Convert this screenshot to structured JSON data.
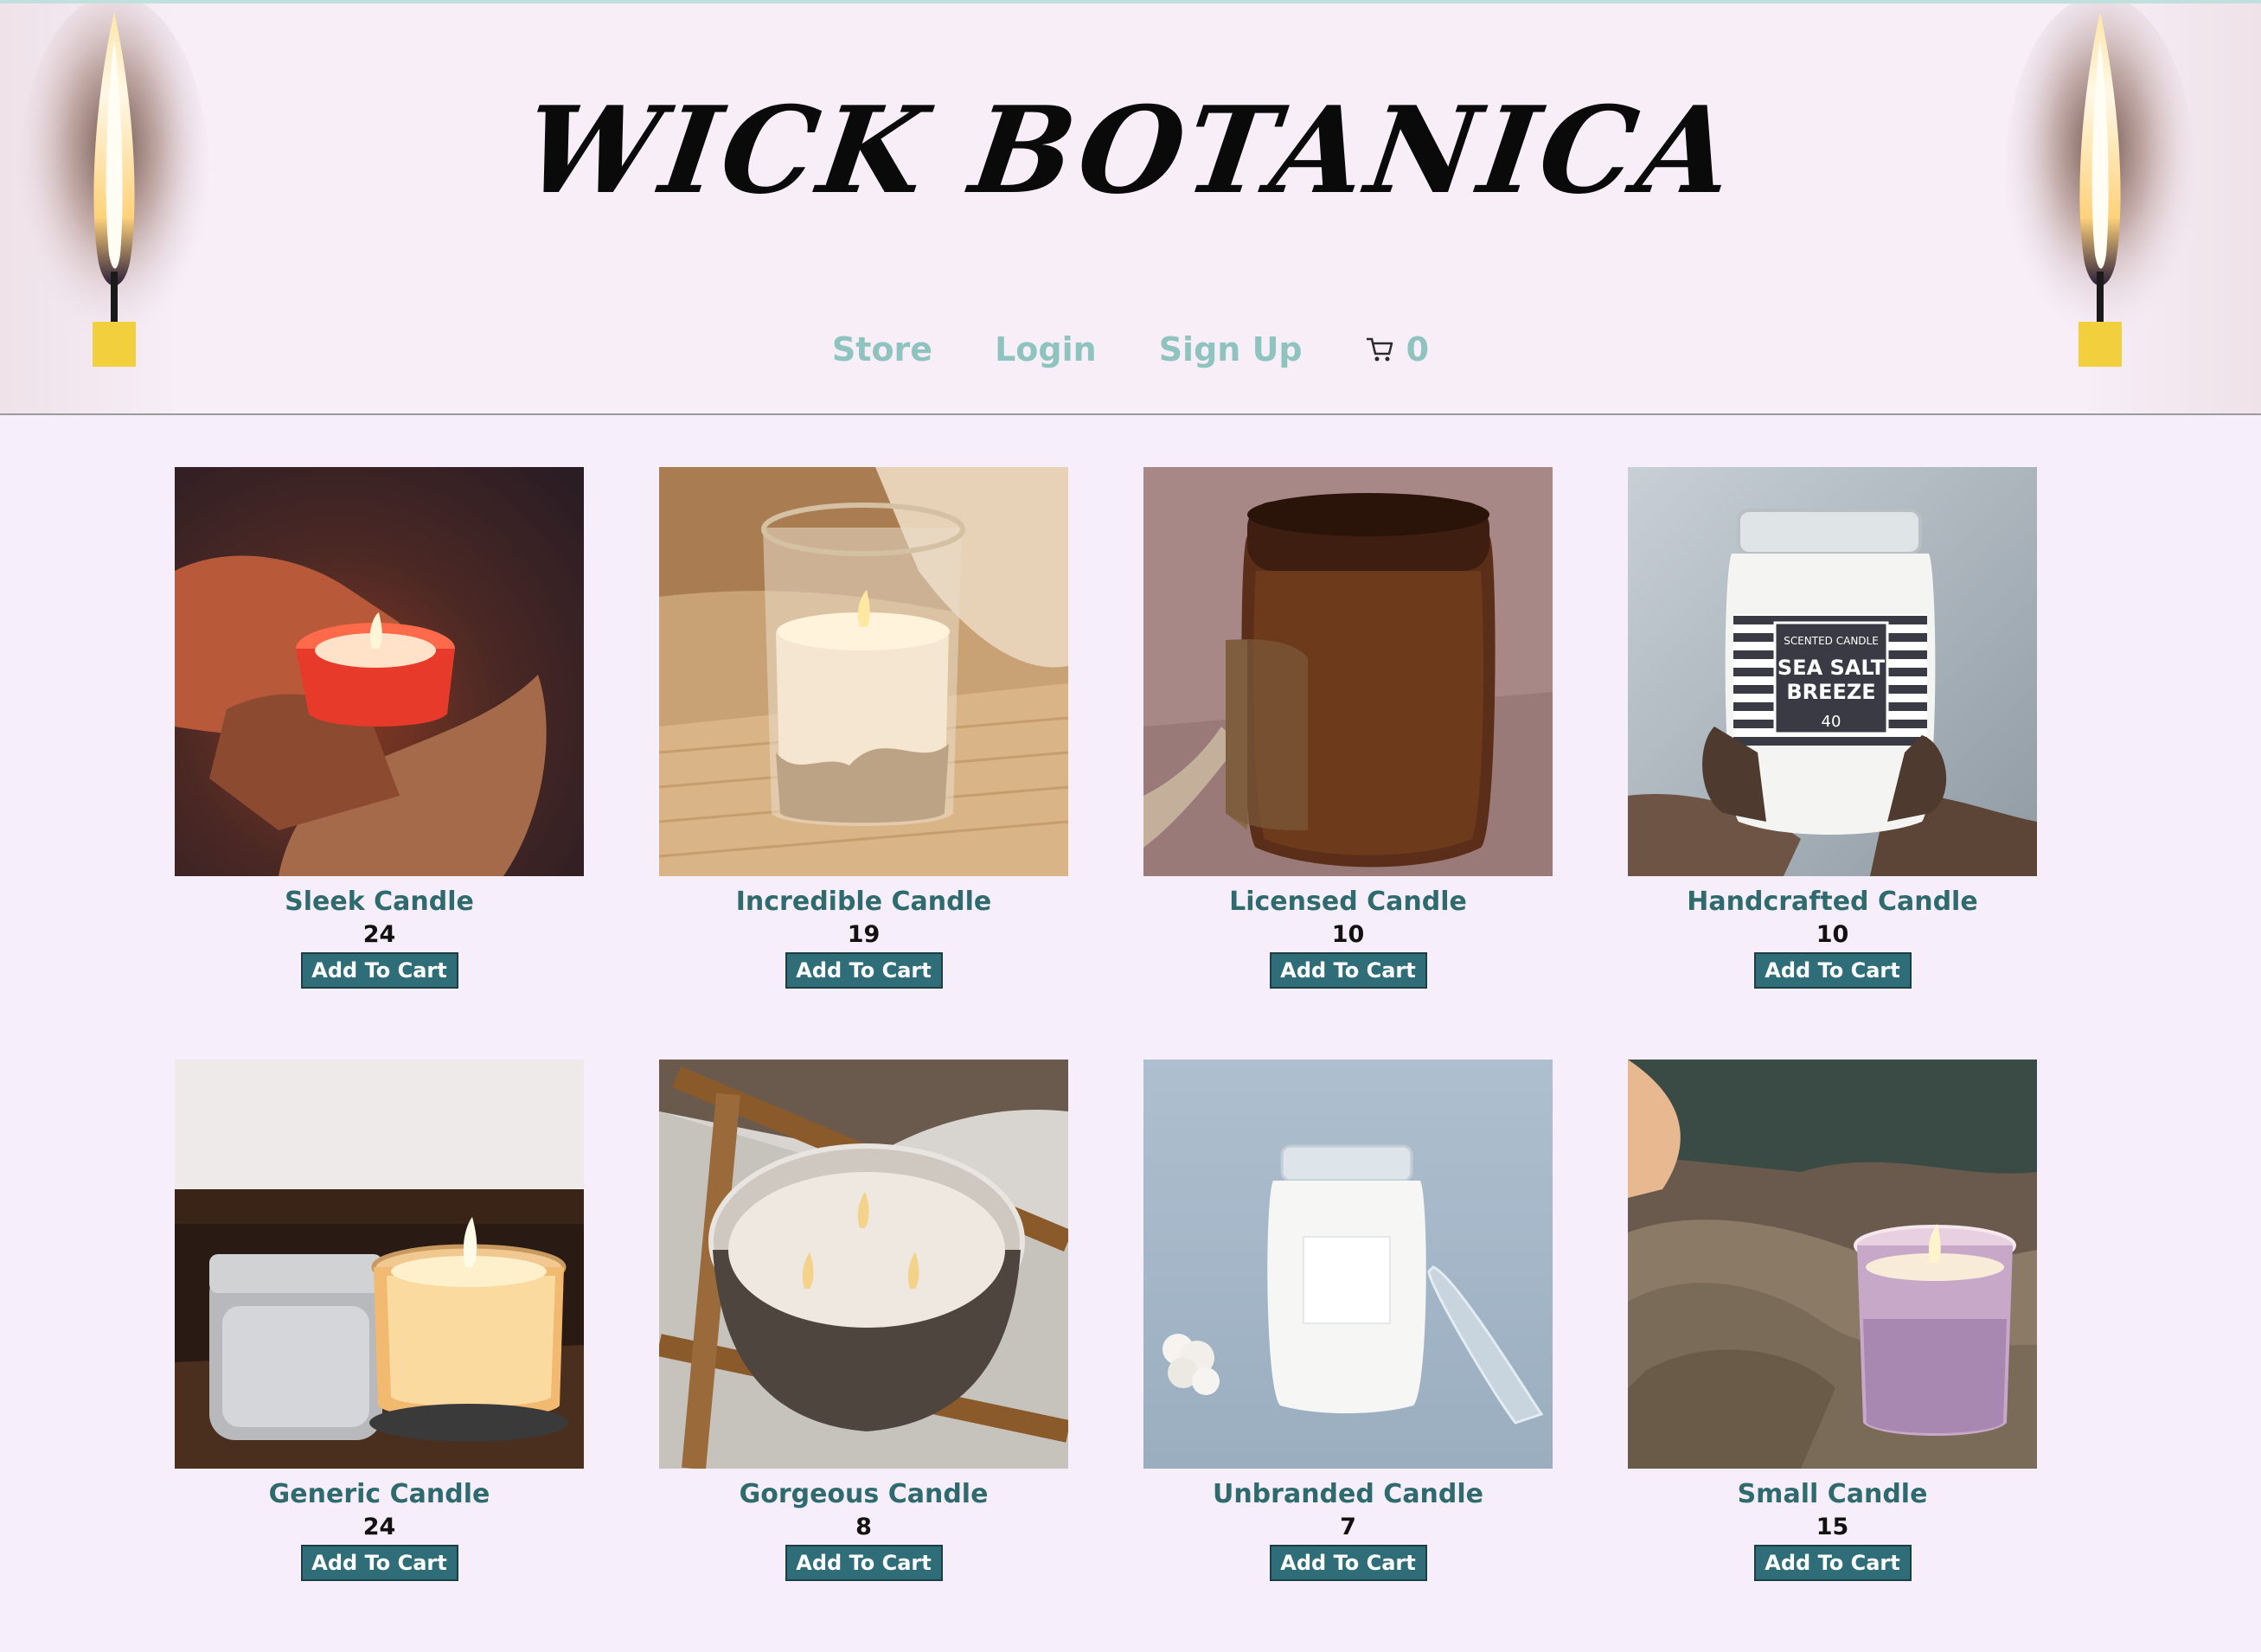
{
  "brand": {
    "title": "WICK BOTANICA"
  },
  "nav": {
    "store": "Store",
    "login": "Login",
    "signup": "Sign Up",
    "cart_count": "0"
  },
  "colors": {
    "accent": "#8fc3c0",
    "button": "#2f6e78",
    "product_name": "#2e6a6e",
    "background": "#f6eefa"
  },
  "products": [
    {
      "name": "Sleek Candle",
      "stock": "24",
      "button": "Add To Cart"
    },
    {
      "name": "Incredible Candle",
      "stock": "19",
      "button": "Add To Cart"
    },
    {
      "name": "Licensed Candle",
      "stock": "10",
      "button": "Add To Cart"
    },
    {
      "name": "Handcrafted Candle",
      "stock": "10",
      "button": "Add To Cart"
    },
    {
      "name": "Generic Candle",
      "stock": "24",
      "button": "Add To Cart"
    },
    {
      "name": "Gorgeous Candle",
      "stock": "8",
      "button": "Add To Cart"
    },
    {
      "name": "Unbranded Candle",
      "stock": "7",
      "button": "Add To Cart"
    },
    {
      "name": "Small Candle",
      "stock": "15",
      "button": "Add To Cart"
    }
  ],
  "jar_label": {
    "line1": "SCENTED CANDLE",
    "line2": "SEA SALT",
    "line3": "BREEZE",
    "line4": "40"
  }
}
